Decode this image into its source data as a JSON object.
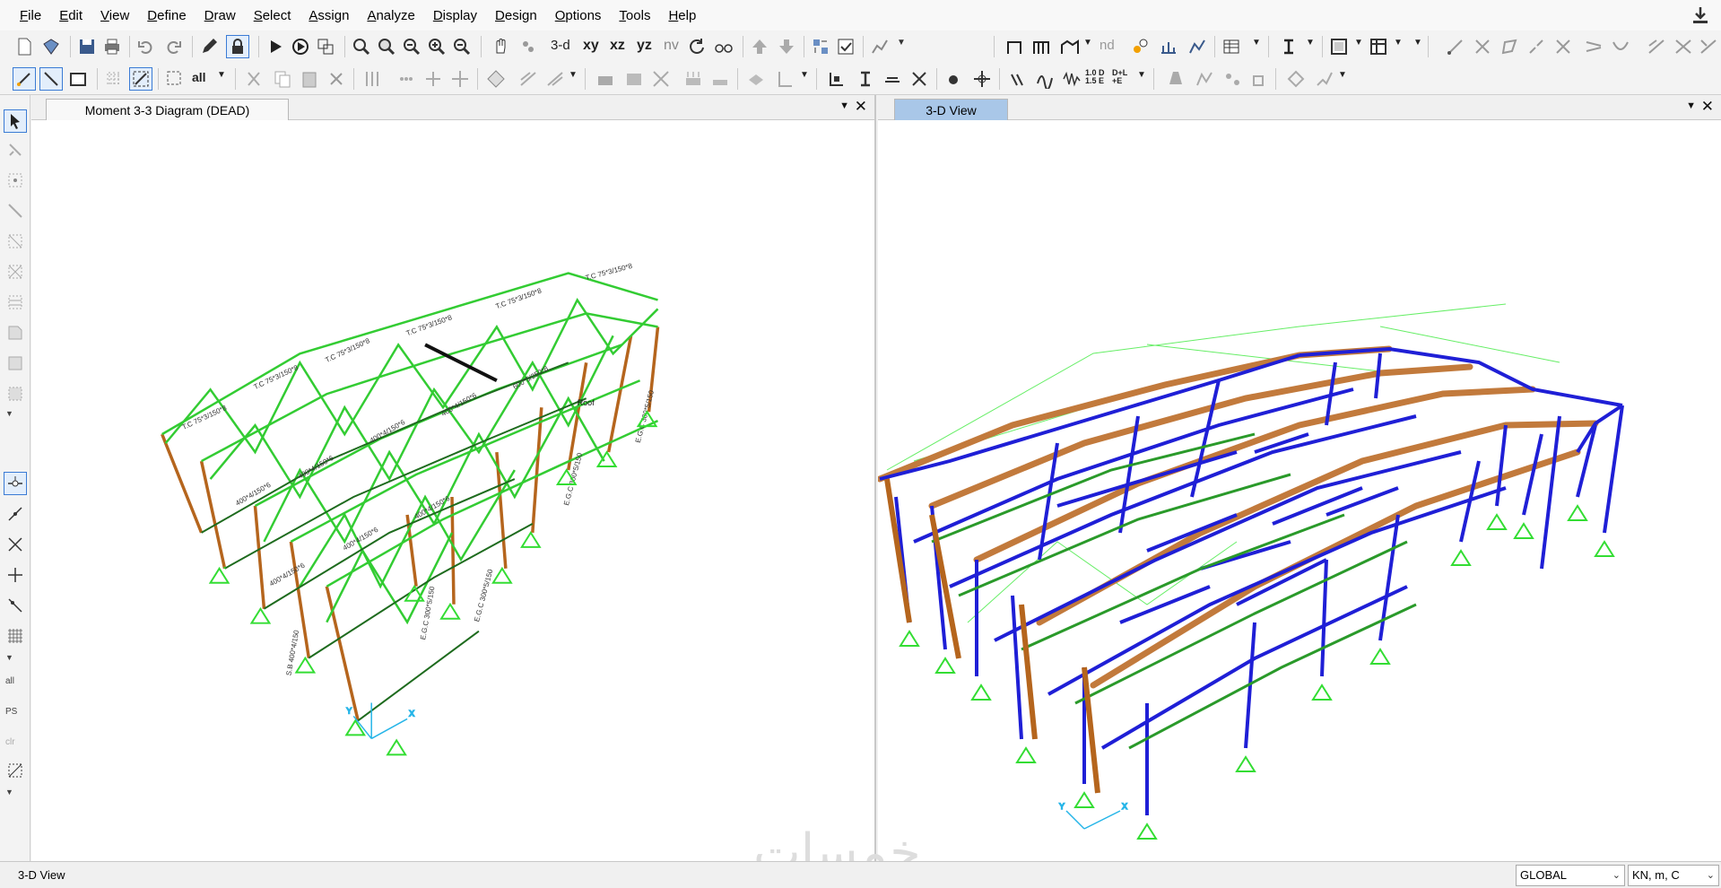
{
  "menubar": {
    "items": [
      "File",
      "Edit",
      "View",
      "Define",
      "Draw",
      "Select",
      "Assign",
      "Analyze",
      "Display",
      "Design",
      "Options",
      "Tools",
      "Help"
    ]
  },
  "toolbar": {
    "view_3d": "3-d",
    "view_xy": "xy",
    "view_xz": "xz",
    "view_yz": "yz",
    "view_nv": "nv",
    "nd_label": "nd",
    "load_label_1": "1.0 D",
    "load_label_2": "1.5 E",
    "load_label_3": "D+L",
    "load_label_4": "+E",
    "select_all": "all"
  },
  "left_toolbar": {
    "all_label": "all",
    "ps_label": "PS",
    "clr_label": "clr"
  },
  "left_panel": {
    "tab_title": "Moment 3-3 Diagram (DEAD)",
    "annotation": "Roof"
  },
  "right_panel": {
    "tab_title": "3-D View"
  },
  "statusbar": {
    "view_name": "3-D View",
    "coord_system": "GLOBAL",
    "units": "KN, m, C"
  },
  "watermark": "خمسات",
  "colors": {
    "truss_green": "#33cc33",
    "column_brown": "#b5651d",
    "frame_blue": "#1f1fd6",
    "support_green": "#33dd33",
    "tab_active": "#a9c7e8"
  }
}
